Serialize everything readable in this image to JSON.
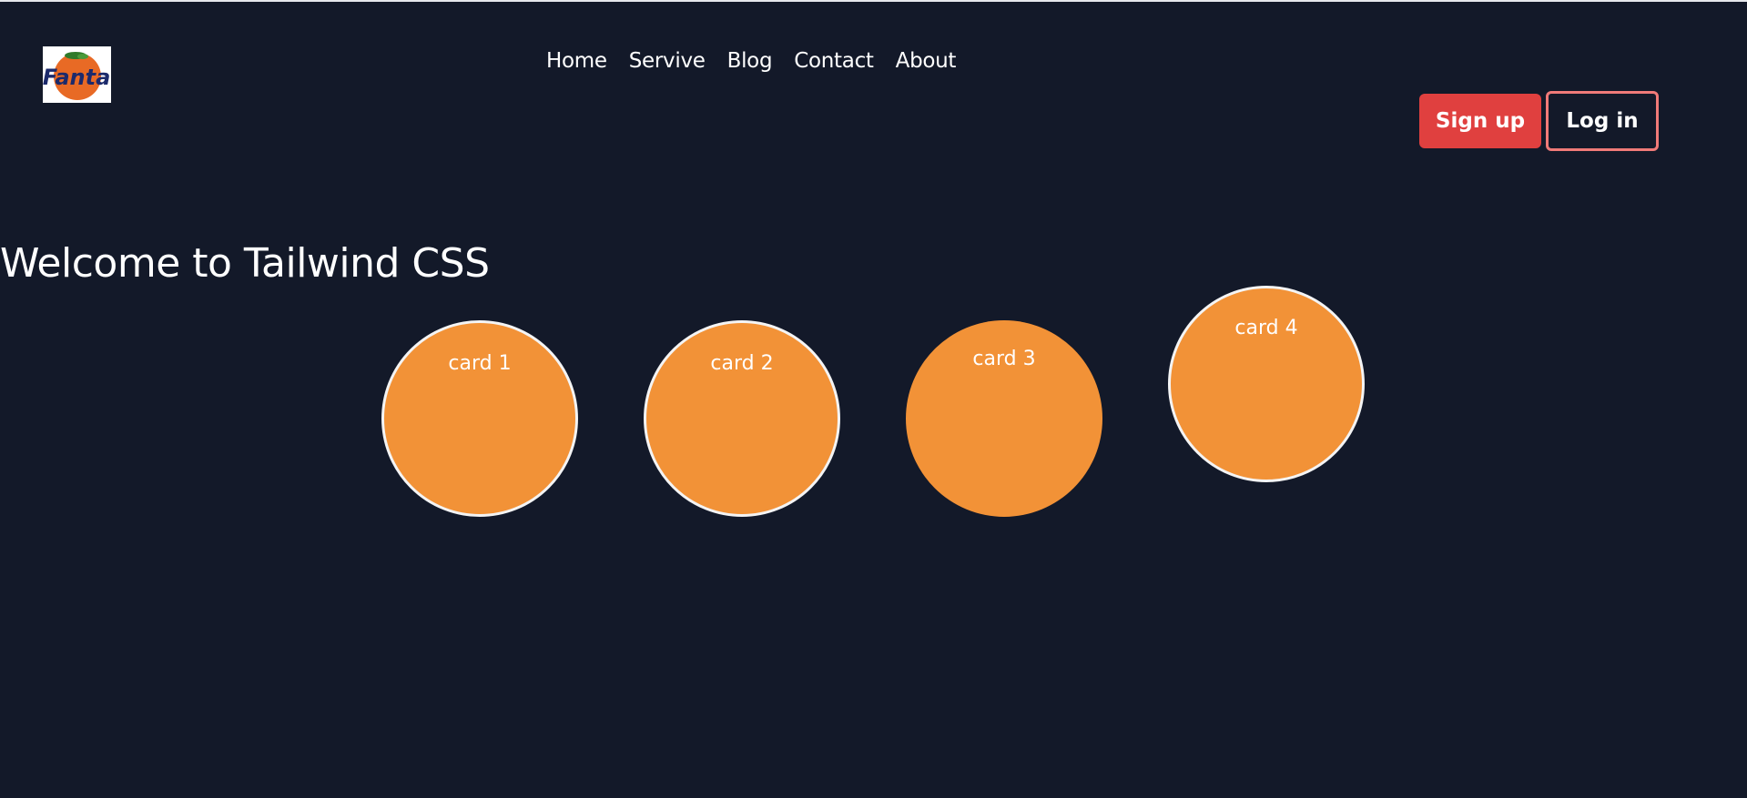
{
  "brand": {
    "logo_text": "Fanta"
  },
  "nav": {
    "items": [
      {
        "label": "Home"
      },
      {
        "label": "Servive"
      },
      {
        "label": "Blog"
      },
      {
        "label": "Contact"
      },
      {
        "label": "About"
      }
    ]
  },
  "auth": {
    "signup_label": "Sign up",
    "login_label": "Log in"
  },
  "hero": {
    "title": "Welcome to Tailwind CSS"
  },
  "cards": [
    {
      "label": "card 1"
    },
    {
      "label": "card 2"
    },
    {
      "label": "card 3"
    },
    {
      "label": "card 4"
    }
  ],
  "colors": {
    "background": "#131929",
    "card_fill": "#f29237",
    "signup_bg": "#e0403f",
    "login_border": "#f07a78",
    "logo_navy": "#1c2a6b",
    "logo_orange": "#e86a25"
  }
}
